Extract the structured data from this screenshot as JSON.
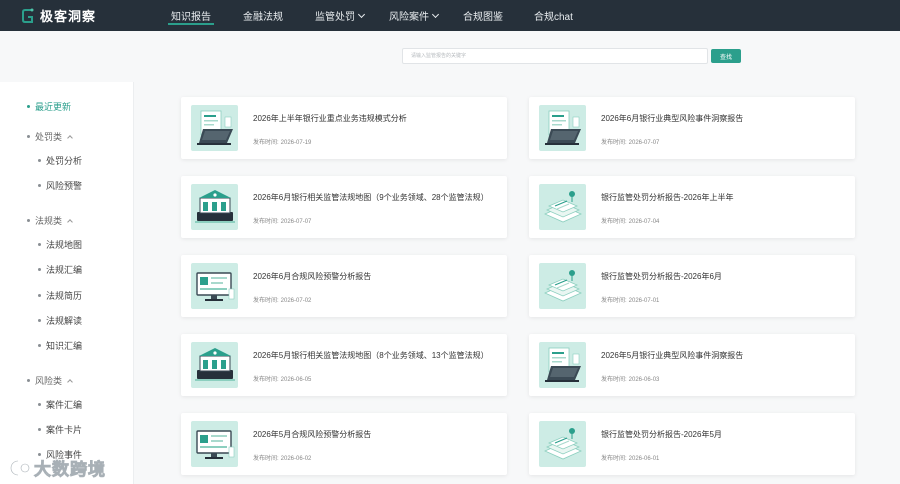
{
  "brand": {
    "name": "极客洞察"
  },
  "nav": [
    {
      "label": "知识报告",
      "active": true,
      "dropdown": false
    },
    {
      "label": "金融法规",
      "active": false,
      "dropdown": false
    },
    {
      "label": "监管处罚",
      "active": false,
      "dropdown": true
    },
    {
      "label": "风险案件",
      "active": false,
      "dropdown": true
    },
    {
      "label": "合规图鉴",
      "active": false,
      "dropdown": false
    },
    {
      "label": "合规chat",
      "active": false,
      "dropdown": false
    }
  ],
  "search": {
    "placeholder": "请输入监管报告的关键字",
    "button": "查找"
  },
  "sidebar": {
    "latest": "最近更新",
    "sections": [
      {
        "label": "处罚类",
        "items": [
          "处罚分析",
          "风险预警"
        ]
      },
      {
        "label": "法规类",
        "items": [
          "法规地图",
          "法规汇编",
          "法规简历",
          "法规解读",
          "知识汇编"
        ]
      },
      {
        "label": "风险类",
        "items": [
          "案件汇编",
          "案件卡片",
          "风险事件"
        ]
      }
    ]
  },
  "date_label": "发布时间:",
  "cards": [
    {
      "title": "2026年上半年银行业重点业务违规模式分析",
      "date": "2026-07-19",
      "icon": "laptop-report-icon"
    },
    {
      "title": "2026年6月银行业典型风险事件洞察报告",
      "date": "2026-07-07",
      "icon": "laptop-report-icon"
    },
    {
      "title": "2026年6月银行相关监管法规地图（9个业务领域、28个监管法规）",
      "date": "2026-07-07",
      "icon": "building-map-icon"
    },
    {
      "title": "银行监管处罚分析报告-2026年上半年",
      "date": "2026-07-04",
      "icon": "document-stack-icon"
    },
    {
      "title": "2026年6月合规风险预警分析报告",
      "date": "2026-07-02",
      "icon": "monitor-chart-icon"
    },
    {
      "title": "银行监管处罚分析报告-2026年6月",
      "date": "2026-07-01",
      "icon": "document-stack-icon"
    },
    {
      "title": "2026年5月银行相关监管法规地图（8个业务领域、13个监管法规）",
      "date": "2026-06-05",
      "icon": "building-map-icon"
    },
    {
      "title": "2026年5月银行业典型风险事件洞察报告",
      "date": "2026-06-03",
      "icon": "laptop-report-icon"
    },
    {
      "title": "2026年5月合规风险预警分析报告",
      "date": "2026-06-02",
      "icon": "monitor-chart-icon"
    },
    {
      "title": "银行监管处罚分析报告-2026年5月",
      "date": "2026-06-01",
      "icon": "document-stack-icon"
    }
  ],
  "watermark": {
    "text": "大数跨境"
  },
  "colors": {
    "accent": "#2b9f8c",
    "nav_bg": "#26303a",
    "thumb_bg": "#cdece5"
  }
}
